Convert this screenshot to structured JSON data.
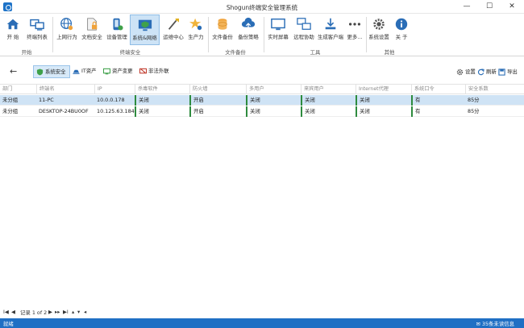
{
  "window": {
    "title": "Shogun终端安全管理系统",
    "minimize": "—",
    "maximize": "☐",
    "close": "✕"
  },
  "ribbon": {
    "buttons": [
      {
        "label": "开 始",
        "icon": "home-icon"
      },
      {
        "label": "终端列表",
        "icon": "terminal-list-icon"
      },
      {
        "label": "上网行为",
        "icon": "web-behavior-icon"
      },
      {
        "label": "文档安全",
        "icon": "document-security-icon"
      },
      {
        "label": "设备管理",
        "icon": "device-management-icon"
      },
      {
        "label": "系统&网络",
        "icon": "system-network-icon"
      },
      {
        "label": "运维中心",
        "icon": "ops-center-icon"
      },
      {
        "label": "生产力",
        "icon": "productivity-icon"
      },
      {
        "label": "文件备份",
        "icon": "file-backup-icon"
      },
      {
        "label": "备份策略",
        "icon": "backup-policy-icon"
      },
      {
        "label": "实时屏幕",
        "icon": "live-screen-icon"
      },
      {
        "label": "远程协助",
        "icon": "remote-assist-icon"
      },
      {
        "label": "生成客户端",
        "icon": "generate-client-icon"
      },
      {
        "label": "更多...",
        "icon": "more-icon"
      },
      {
        "label": "系统设置",
        "icon": "settings-icon"
      },
      {
        "label": "关 于",
        "icon": "info-icon"
      }
    ],
    "groups": [
      "开始",
      "终端安全",
      "文件备份",
      "工具",
      "其他"
    ]
  },
  "subtabs": [
    "系统安全",
    "IT资产",
    "资产变更",
    "非法外联"
  ],
  "right_tools": {
    "settings": "设置",
    "refresh": "刷新",
    "export": "导出"
  },
  "table": {
    "columns": [
      "部门",
      "终端名",
      "IP",
      "杀毒软件",
      "防火墙",
      "多用户",
      "来宾用户",
      "Internet代理",
      "系统口令",
      "安全系数"
    ],
    "rows": [
      [
        "未分组",
        "11-PC",
        "10.0.0.178",
        "关闭",
        "开启",
        "关闭",
        "关闭",
        "关闭",
        "有",
        "85分"
      ],
      [
        "未分组",
        "DESKTOP-24BU0OF",
        "10.125.63.184",
        "关闭",
        "开启",
        "关闭",
        "关闭",
        "关闭",
        "有",
        "85分"
      ]
    ]
  },
  "pager": {
    "first": "I◀",
    "prev": "◀",
    "record": "记录 1 of 2",
    "next": "▶",
    "nextpage": "▸▸",
    "last": "▶I",
    "up": "▴",
    "down": "▾",
    "left": "◂"
  },
  "status": {
    "left": "就绪",
    "right": "35条未读信息"
  },
  "colors": {
    "accent": "#1f6fc4",
    "selected_row": "#cfe3f5",
    "status_green": "#2e8b3e"
  }
}
